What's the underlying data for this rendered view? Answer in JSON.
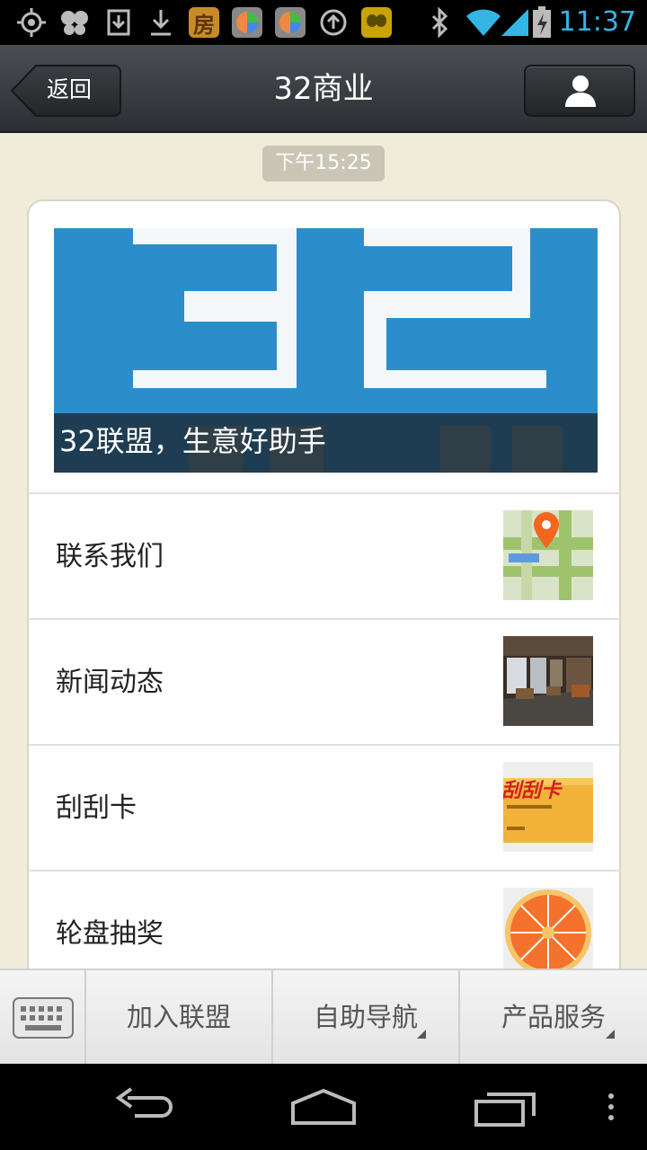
{
  "status_bar": {
    "time": "11:37",
    "icons": [
      "gps-icon",
      "app-butterfly-icon",
      "download-box-icon",
      "download-icon",
      "app-fang-icon",
      "app-color-icon",
      "app-color-icon",
      "sync-icon",
      "app-yellow-icon",
      "bluetooth-icon",
      "wifi-icon",
      "signal-icon",
      "battery-charging-icon"
    ],
    "fang_label": "房"
  },
  "header": {
    "back_label": "返回",
    "title": "32商业",
    "profile_icon": "person-icon"
  },
  "chat": {
    "timestamp": "下午15:25",
    "card": {
      "cover_caption": "32联盟，生意好助手",
      "items": [
        {
          "label": "联系我们",
          "thumb": "map-pin-thumbnail"
        },
        {
          "label": "新闻动态",
          "thumb": "restaurant-thumbnail"
        },
        {
          "label": "刮刮卡",
          "thumb": "scratch-card-thumbnail",
          "thumb_text": "刮刮卡"
        },
        {
          "label": "轮盘抽奖",
          "thumb": "prize-wheel-thumbnail"
        }
      ]
    }
  },
  "bottom_menu": {
    "keyboard_icon": "keyboard-icon",
    "tabs": [
      {
        "label": "加入联盟",
        "has_submenu": false
      },
      {
        "label": "自助导航",
        "has_submenu": true
      },
      {
        "label": "产品服务",
        "has_submenu": true
      }
    ]
  },
  "nav_bar": {
    "buttons": [
      "back-nav-icon",
      "home-nav-icon",
      "recents-nav-icon",
      "overflow-menu-icon"
    ]
  },
  "colors": {
    "chat_background": "#f0ecd9",
    "status_time": "#33b5e5",
    "cover_blue": "#2b8ecb"
  }
}
